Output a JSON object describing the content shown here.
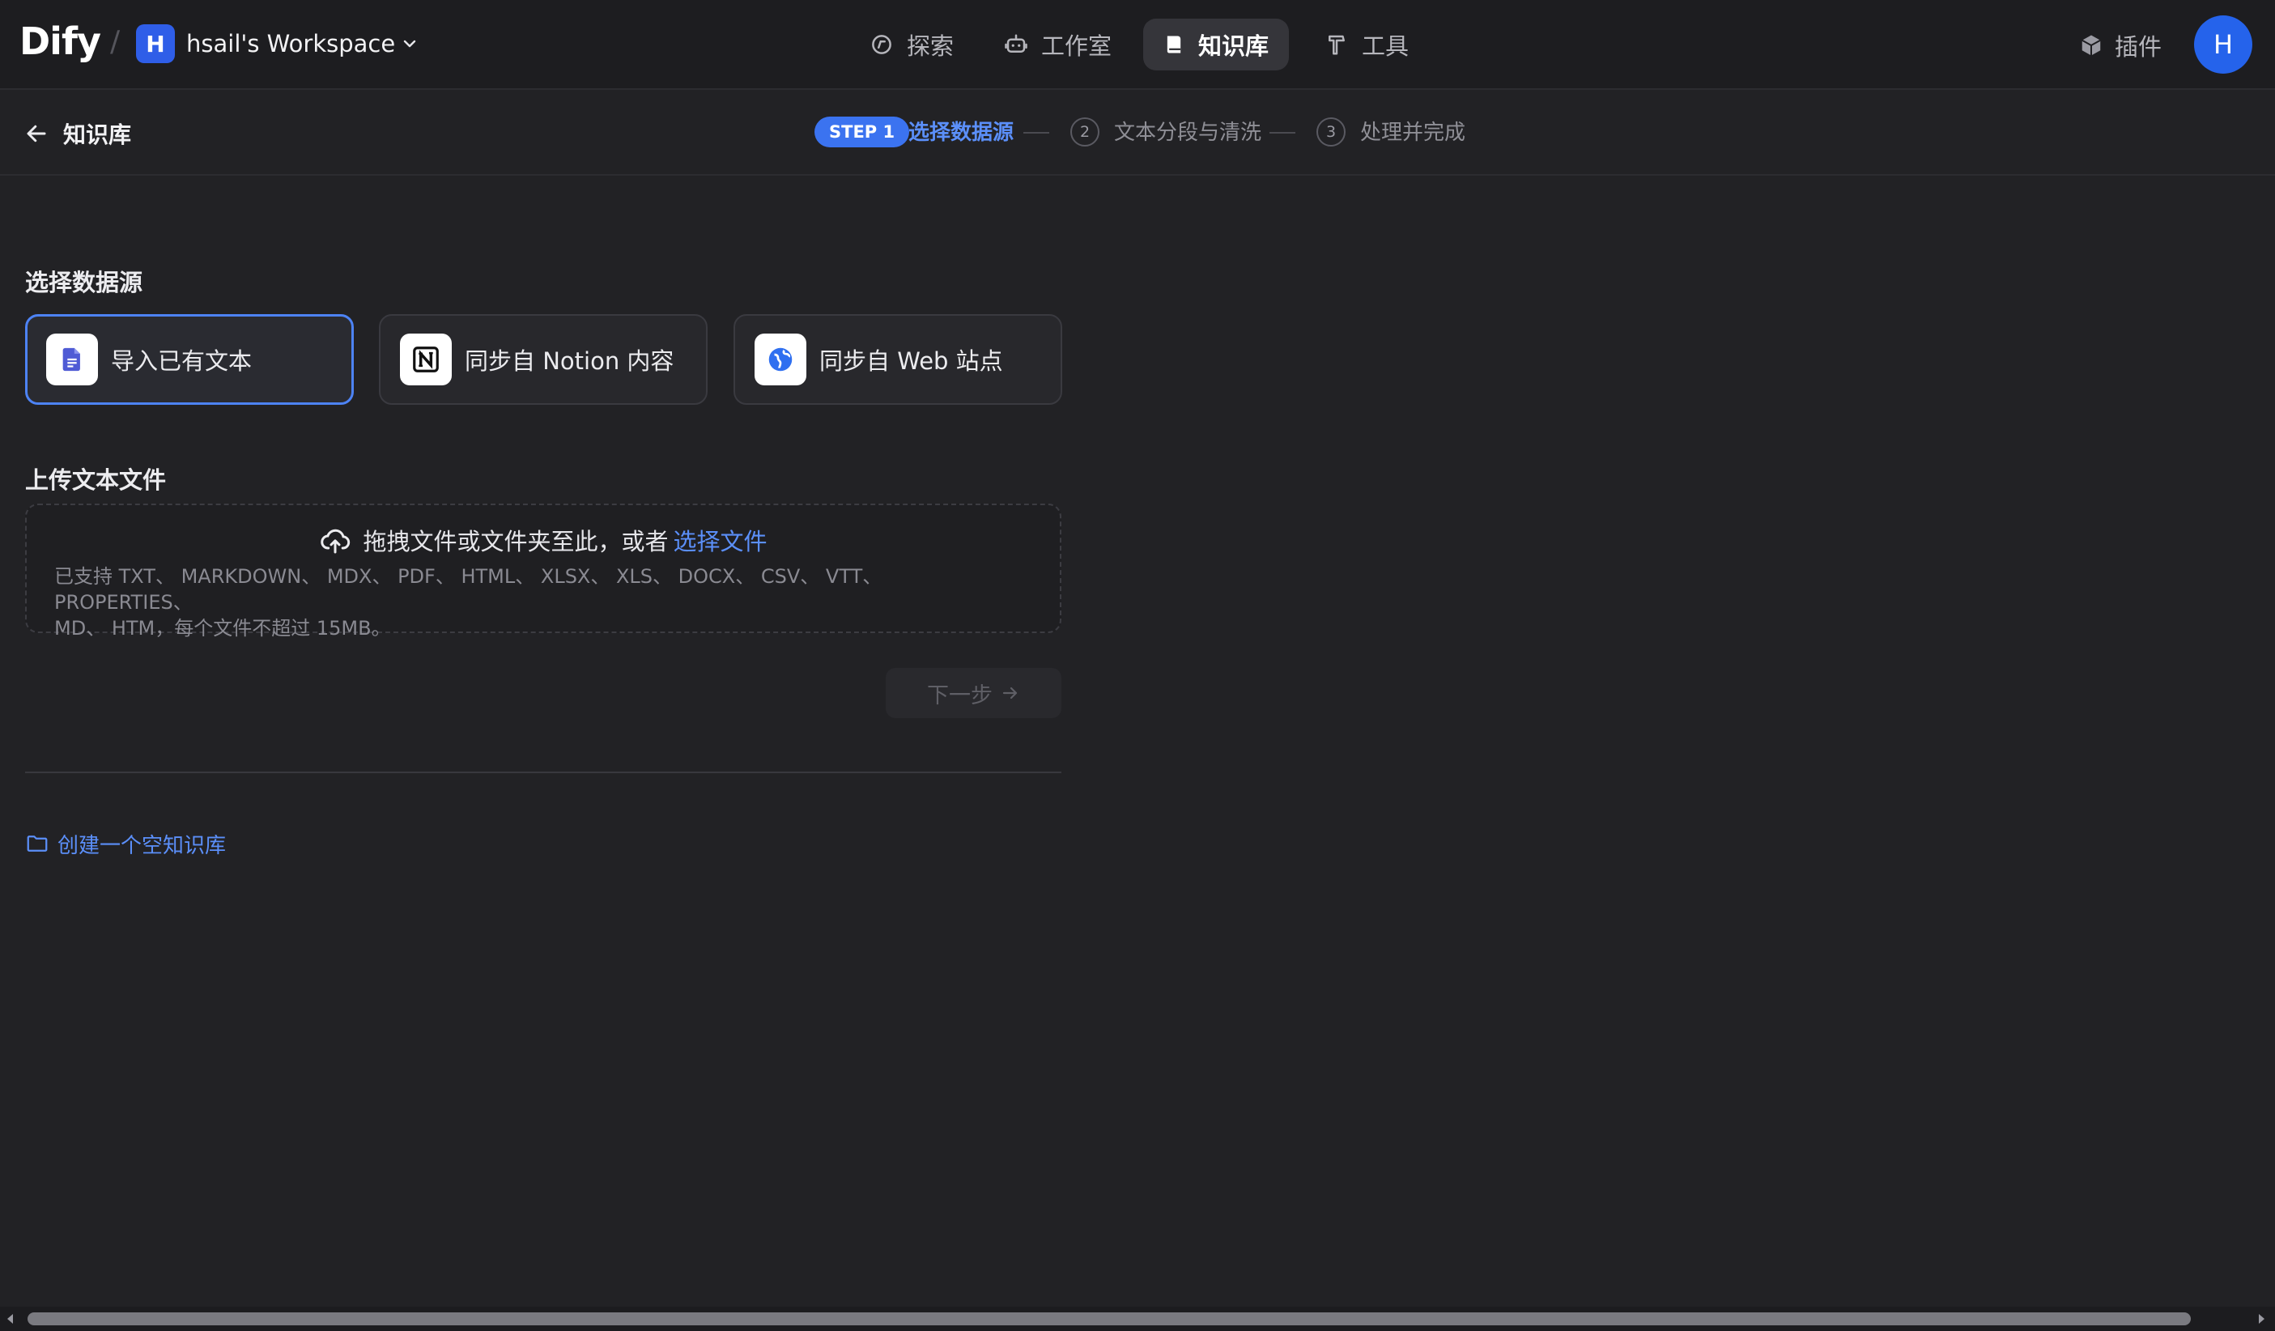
{
  "brand": {
    "logo": "Dify",
    "separator": "/"
  },
  "workspace": {
    "initial": "H",
    "name": "hsail's Workspace"
  },
  "nav": {
    "items": [
      {
        "label": "探索",
        "icon": "compass-icon",
        "active": false
      },
      {
        "label": "工作室",
        "icon": "robot-icon",
        "active": false
      },
      {
        "label": "知识库",
        "icon": "book-icon",
        "active": true
      },
      {
        "label": "工具",
        "icon": "hammer-icon",
        "active": false
      }
    ],
    "plugins_label": "插件",
    "user_initial": "H"
  },
  "header": {
    "back_label": "知识库",
    "steps": {
      "step1_tag": "STEP 1",
      "step1_label": "选择数据源",
      "step2_num": "2",
      "step2_label": "文本分段与清洗",
      "step3_num": "3",
      "step3_label": "处理并完成"
    }
  },
  "datasource": {
    "title": "选择数据源",
    "options": [
      {
        "label": "导入已有文本",
        "icon": "file-text-icon",
        "selected": true
      },
      {
        "label": "同步自 Notion 内容",
        "icon": "notion-icon",
        "selected": false
      },
      {
        "label": "同步自 Web 站点",
        "icon": "globe-icon",
        "selected": false
      }
    ]
  },
  "upload": {
    "title": "上传文本文件",
    "drop_text": "拖拽文件或文件夹至此，或者",
    "select_link": "选择文件",
    "supported_line1": "已支持 TXT、 MARKDOWN、 MDX、 PDF、 HTML、 XLSX、 XLS、 DOCX、 CSV、 VTT、 PROPERTIES、",
    "supported_line2": "MD、 HTM，每个文件不超过 15MB。"
  },
  "actions": {
    "next_label": "下一步",
    "create_empty_label": "创建一个空知识库"
  },
  "colors": {
    "accent": "#4d83f5",
    "link": "#5b8ff9",
    "background": "#222225",
    "topbar": "#1d1d20"
  }
}
